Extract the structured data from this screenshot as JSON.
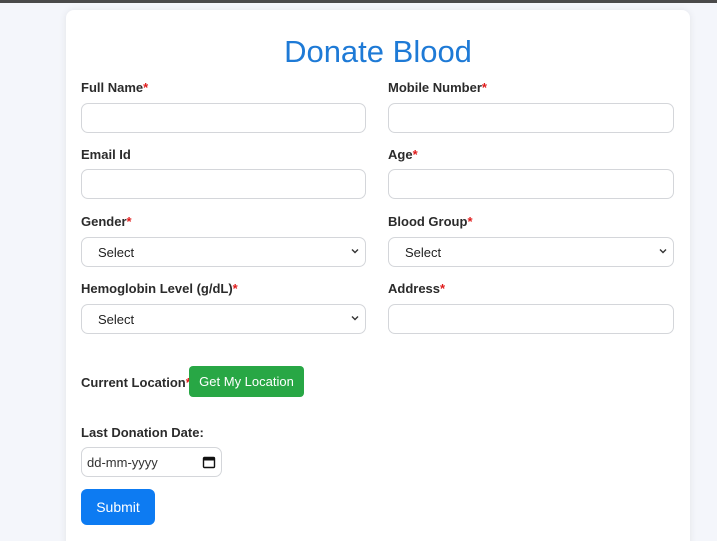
{
  "form": {
    "title": "Donate Blood",
    "required_marker": "*",
    "fields": {
      "full_name": {
        "label": "Full Name",
        "value": ""
      },
      "mobile_number": {
        "label": "Mobile Number",
        "value": ""
      },
      "email": {
        "label": "Email Id",
        "value": ""
      },
      "age": {
        "label": "Age",
        "value": ""
      },
      "gender": {
        "label": "Gender",
        "selected": "Select"
      },
      "blood_group": {
        "label": "Blood Group",
        "selected": "Select"
      },
      "hemoglobin": {
        "label": "Hemoglobin Level (g/dL)",
        "selected": "Select"
      },
      "address": {
        "label": "Address",
        "value": ""
      },
      "current_location": {
        "label": "Current Location",
        "button_label": "Get My Location"
      },
      "last_donation_date": {
        "label": "Last Donation Date:",
        "placeholder": "dd-mm-yyyy"
      }
    },
    "submit_label": "Submit"
  },
  "colors": {
    "title": "#1e7ad6",
    "required": "#e01b1b",
    "location_button": "#28a745",
    "submit_button": "#0d7bf2"
  },
  "icons": {
    "dropdown": "chevron-down-icon",
    "date_picker": "calendar-icon"
  }
}
